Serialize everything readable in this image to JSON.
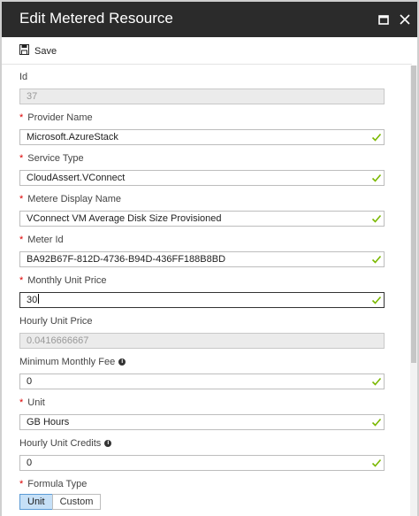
{
  "window": {
    "title": "Edit Metered Resource"
  },
  "toolbar": {
    "save_label": "Save"
  },
  "fields": {
    "id": {
      "label": "Id",
      "value": "37"
    },
    "provider_name": {
      "label": "Provider Name",
      "value": "Microsoft.AzureStack"
    },
    "service_type": {
      "label": "Service Type",
      "value": "CloudAssert.VConnect"
    },
    "display_name": {
      "label": "Metere Display Name",
      "value": "VConnect VM Average Disk Size Provisioned"
    },
    "meter_id": {
      "label": "Meter Id",
      "value": "BA92B67F-812D-4736-B94D-436FF188B8BD"
    },
    "monthly_unit_price": {
      "label": "Monthly Unit Price",
      "value": "30"
    },
    "hourly_unit_price": {
      "label": "Hourly Unit Price",
      "value": "0.0416666667"
    },
    "minimum_monthly_fee": {
      "label": "Minimum Monthly Fee",
      "value": "0"
    },
    "unit": {
      "label": "Unit",
      "value": "GB Hours"
    },
    "hourly_unit_credits": {
      "label": "Hourly Unit Credits",
      "value": "0"
    },
    "formula_type": {
      "label": "Formula Type",
      "options": [
        "Unit",
        "Custom"
      ],
      "selected": "Unit"
    }
  },
  "required_marker": "*",
  "info_glyph": "i",
  "colors": {
    "titlebar": "#2b2b2b",
    "check": "#7ab800",
    "required": "#dd0000",
    "selected_option": "#c6e0f7"
  },
  "icons": [
    "save-icon",
    "maximize-icon",
    "close-icon",
    "checkmark-icon",
    "info-icon"
  ]
}
